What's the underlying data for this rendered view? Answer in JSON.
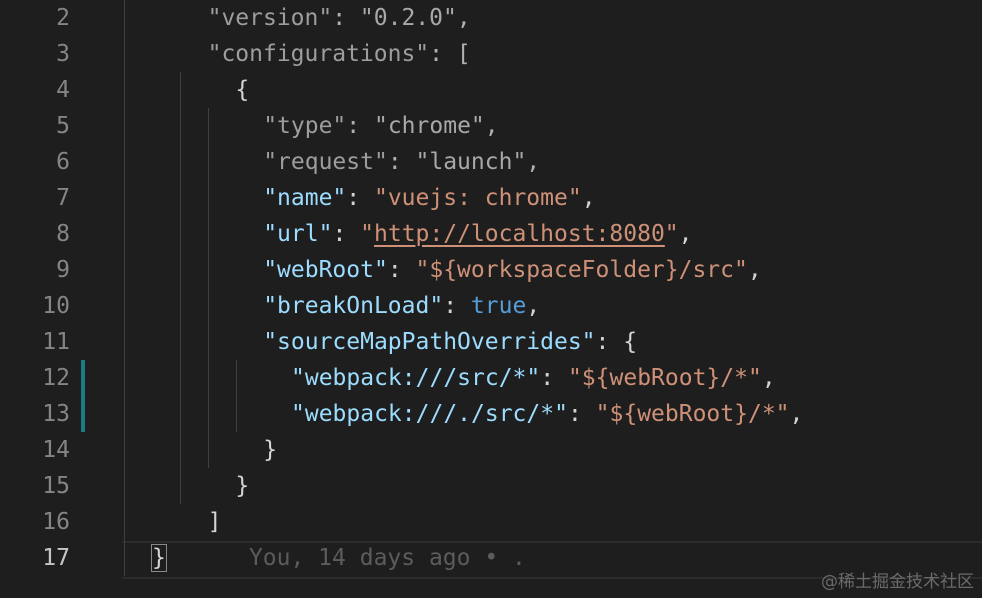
{
  "lines": [
    {
      "num": "2",
      "parts": [
        {
          "t": "\"version\"",
          "c": "k-dim"
        },
        {
          "t": ": ",
          "c": "p-dim"
        },
        {
          "t": "\"0.2.0\"",
          "c": "s-dim"
        },
        {
          "t": ",",
          "c": "p-dim"
        }
      ]
    },
    {
      "num": "3",
      "parts": [
        {
          "t": "\"configurations\"",
          "c": "k-dim"
        },
        {
          "t": ": [",
          "c": "p-dim"
        }
      ]
    },
    {
      "num": "4",
      "parts": [
        {
          "t": "{",
          "c": "p"
        }
      ]
    },
    {
      "num": "5",
      "parts": [
        {
          "t": "\"type\"",
          "c": "k-dim"
        },
        {
          "t": ": ",
          "c": "p-dim"
        },
        {
          "t": "\"chrome\"",
          "c": "s-dim"
        },
        {
          "t": ",",
          "c": "p-dim"
        }
      ]
    },
    {
      "num": "6",
      "parts": [
        {
          "t": "\"request\"",
          "c": "k-dim"
        },
        {
          "t": ": ",
          "c": "p-dim"
        },
        {
          "t": "\"launch\"",
          "c": "s-dim"
        },
        {
          "t": ",",
          "c": "p-dim"
        }
      ]
    },
    {
      "num": "7",
      "parts": [
        {
          "t": "\"name\"",
          "c": "k"
        },
        {
          "t": ": ",
          "c": "p"
        },
        {
          "t": "\"vuejs: chrome\"",
          "c": "s"
        },
        {
          "t": ",",
          "c": "p"
        }
      ]
    },
    {
      "num": "8",
      "parts": [
        {
          "t": "\"url\"",
          "c": "k"
        },
        {
          "t": ": ",
          "c": "p"
        },
        {
          "t": "\"",
          "c": "s"
        },
        {
          "t": "http://localhost:8080",
          "c": "url"
        },
        {
          "t": "\"",
          "c": "s"
        },
        {
          "t": ",",
          "c": "p"
        }
      ]
    },
    {
      "num": "9",
      "parts": [
        {
          "t": "\"webRoot\"",
          "c": "k"
        },
        {
          "t": ": ",
          "c": "p"
        },
        {
          "t": "\"${workspaceFolder}/src\"",
          "c": "s"
        },
        {
          "t": ",",
          "c": "p"
        }
      ]
    },
    {
      "num": "10",
      "parts": [
        {
          "t": "\"breakOnLoad\"",
          "c": "k"
        },
        {
          "t": ": ",
          "c": "p"
        },
        {
          "t": "true",
          "c": "b"
        },
        {
          "t": ",",
          "c": "p"
        }
      ]
    },
    {
      "num": "11",
      "parts": [
        {
          "t": "\"sourceMapPathOverrides\"",
          "c": "k"
        },
        {
          "t": ": {",
          "c": "p"
        }
      ]
    },
    {
      "num": "12",
      "parts": [
        {
          "t": "\"webpack:///src/*\"",
          "c": "k"
        },
        {
          "t": ": ",
          "c": "p"
        },
        {
          "t": "\"${webRoot}/*\"",
          "c": "s"
        },
        {
          "t": ",",
          "c": "p"
        }
      ]
    },
    {
      "num": "13",
      "parts": [
        {
          "t": "\"webpack:///./src/*\"",
          "c": "k"
        },
        {
          "t": ": ",
          "c": "p"
        },
        {
          "t": "\"${webRoot}/*\"",
          "c": "s"
        },
        {
          "t": ",",
          "c": "p"
        }
      ]
    },
    {
      "num": "14",
      "parts": [
        {
          "t": "}",
          "c": "p"
        }
      ]
    },
    {
      "num": "15",
      "parts": [
        {
          "t": "}",
          "c": "p"
        }
      ]
    },
    {
      "num": "16",
      "parts": [
        {
          "t": "]",
          "c": "p"
        }
      ]
    },
    {
      "num": "17",
      "active": true,
      "parts": [
        {
          "t": "}",
          "c": "p brace-box"
        },
        {
          "t": "      You, 14 days ago • .",
          "c": "blame"
        }
      ]
    }
  ],
  "watermark": "@稀土掘金技术社区",
  "colors": {
    "background": "#1e1e1e",
    "key": "#9cdcfe",
    "string": "#ce9178",
    "boolean": "#569cd6",
    "git_modified": "#1b7c83"
  }
}
